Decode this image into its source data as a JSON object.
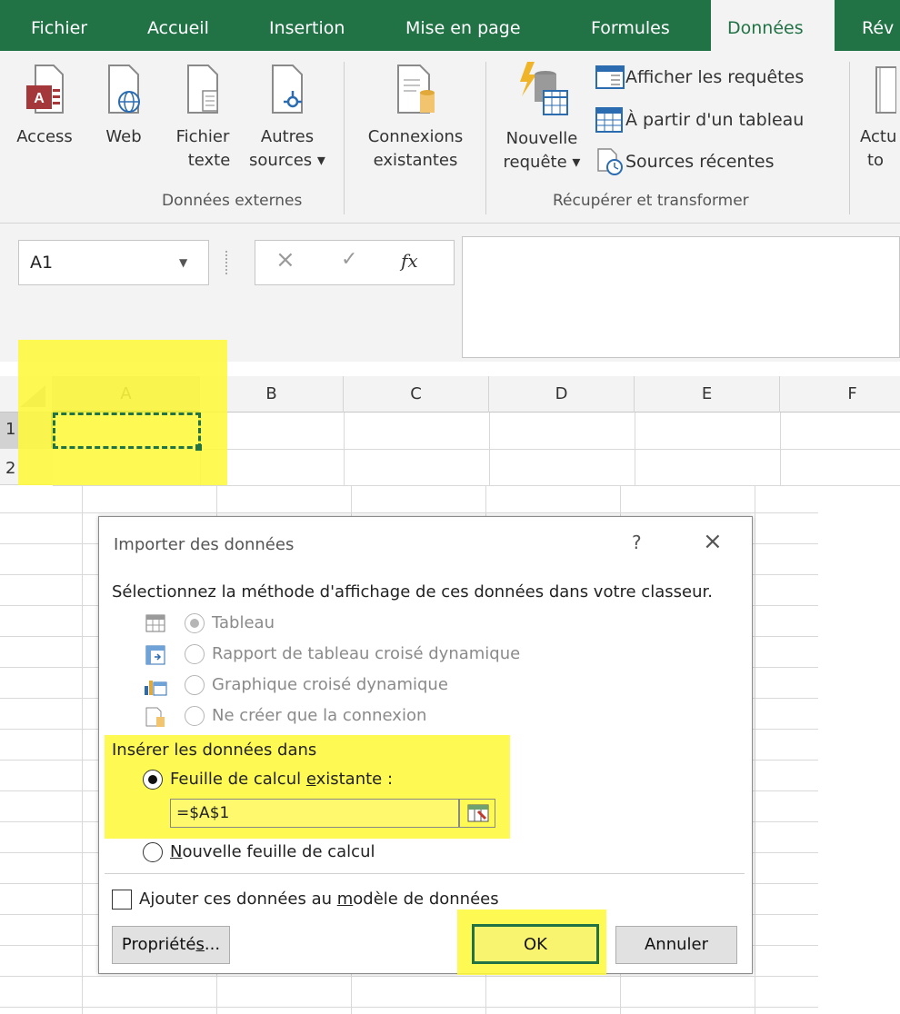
{
  "ribbon": {
    "tabs": [
      "Fichier",
      "Accueil",
      "Insertion",
      "Mise en page",
      "Formules",
      "Données",
      "Rév"
    ],
    "active_tab": "Données",
    "groups": {
      "external": {
        "label": "Données externes",
        "buttons": [
          {
            "line1": "Access",
            "line2": ""
          },
          {
            "line1": "Web",
            "line2": ""
          },
          {
            "line1": "Fichier",
            "line2": "texte"
          },
          {
            "line1": "Autres",
            "line2": "sources ▾"
          },
          {
            "line1": "Connexions",
            "line2": "existantes"
          }
        ]
      },
      "transform": {
        "label": "Récupérer et transformer",
        "new_query": {
          "line1": "Nouvelle",
          "line2": "requête ▾"
        },
        "small_buttons": [
          "Afficher les requêtes",
          "À partir d'un tableau",
          "Sources récentes"
        ]
      },
      "cut": {
        "line1": "Actu",
        "line2": "to"
      }
    }
  },
  "formula_bar": {
    "name_box": "A1",
    "cancel_symbol": "×",
    "enter_symbol": "✓",
    "fx_symbol": "fx",
    "formula_value": ""
  },
  "grid": {
    "columns": [
      "A",
      "B",
      "C",
      "D",
      "E",
      "F"
    ],
    "rows": [
      "1",
      "2"
    ]
  },
  "dialog": {
    "title": "Importer des données",
    "help_symbol": "?",
    "close_symbol": "×",
    "prompt": "Sélectionnez la méthode d'affichage de ces données dans votre classeur.",
    "view_options": [
      {
        "label": "Tableau",
        "selected": true,
        "disabled": true
      },
      {
        "label": "Rapport de tableau croisé dynamique",
        "selected": false,
        "disabled": true
      },
      {
        "label": "Graphique croisé dynamique",
        "selected": false,
        "disabled": true
      },
      {
        "label": "Ne créer que la connexion",
        "selected": false,
        "disabled": true
      }
    ],
    "insert_section": "Insérer les données dans",
    "existing_sheet": {
      "prefix": "Feuille de calcul ",
      "accel": "e",
      "suffix": "xistante :",
      "selected": true
    },
    "range_value": "=$A$1",
    "new_sheet": {
      "accel": "N",
      "suffix": "ouvelle feuille de calcul",
      "selected": false
    },
    "add_to_model": {
      "prefix": "Ajouter ces données au ",
      "accel": "m",
      "suffix": "odèle de données",
      "checked": false
    },
    "properties_button": {
      "prefix": "Propriété",
      "accel": "s",
      "suffix": "..."
    },
    "ok_button": "OK",
    "cancel_button": "Annuler"
  },
  "colors": {
    "excel_green": "#217346",
    "highlight_yellow": "#fff83c",
    "selection_green": "#217346"
  }
}
